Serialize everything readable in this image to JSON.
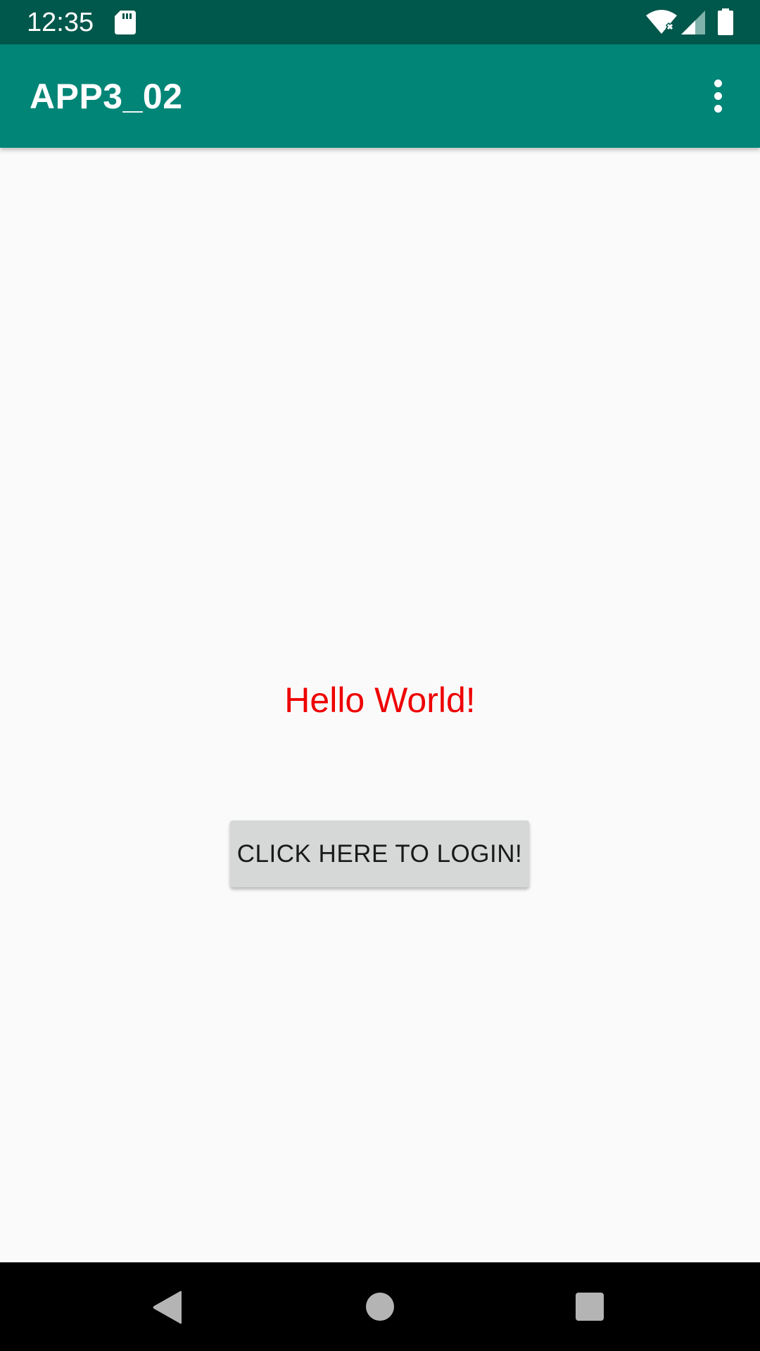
{
  "status_bar": {
    "time": "12:35",
    "icons": [
      "sd-card-icon",
      "wifi-icon",
      "cellular-signal-icon",
      "battery-icon"
    ]
  },
  "app_bar": {
    "title": "APP3_02",
    "menu_icon": "overflow-menu-icon"
  },
  "main": {
    "greeting": "Hello World!",
    "login_button_label": "CLICK HERE TO LOGIN!"
  },
  "nav_bar": {
    "icons": [
      "back-icon",
      "home-icon",
      "recents-icon"
    ]
  },
  "colors": {
    "status_bar": "#00574b",
    "app_bar": "#008577",
    "background": "#fafafa",
    "greeting_text": "#ee0000",
    "button_bg": "#d6d7d7",
    "nav_bar": "#000000"
  }
}
